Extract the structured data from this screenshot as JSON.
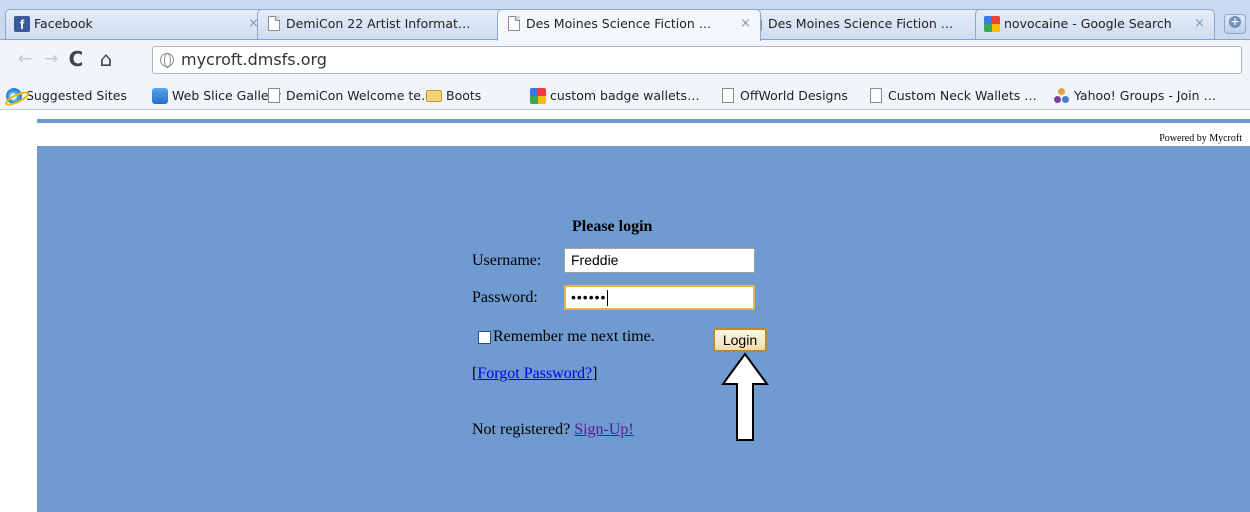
{
  "browser": {
    "tabs": [
      {
        "label": "Facebook",
        "icon": "facebook-icon",
        "active": false
      },
      {
        "label": "DemiCon 22 Artist Informat…",
        "icon": "page-icon",
        "active": false
      },
      {
        "label": "Des Moines Science Fiction …",
        "icon": "page-icon",
        "active": true
      },
      {
        "label": "Des Moines Science Fiction …",
        "icon": "page-icon",
        "active": false
      },
      {
        "label": "novocaine - Google Search",
        "icon": "google-icon",
        "active": false
      }
    ],
    "new_tab_icon": "plus-icon",
    "close_glyph": "×",
    "url": "mycroft.dmsfs.org",
    "bookmarks": [
      {
        "label": "Suggested Sites",
        "icon": "ie-icon"
      },
      {
        "label": "Web Slice Gallery",
        "icon": "web-slice-icon"
      },
      {
        "label": "DemiCon Welcome te…",
        "icon": "page-icon"
      },
      {
        "label": "Boots",
        "icon": "folder-icon"
      },
      {
        "label": "custom badge wallets…",
        "icon": "google-icon"
      },
      {
        "label": "OffWorld Designs",
        "icon": "page-icon"
      },
      {
        "label": "Custom Neck Wallets …",
        "icon": "page-icon"
      },
      {
        "label": "Yahoo! Groups - Join …",
        "icon": "yahoo-groups-icon"
      }
    ]
  },
  "page": {
    "powered_by": "Powered by Mycroft",
    "login": {
      "title": "Please login",
      "username_label": "Username:",
      "username_value": "Freddie",
      "password_label": "Password:",
      "password_mask": "••••••",
      "remember_label": "Remember me next time.",
      "remember_checked": false,
      "login_button": "Login",
      "forgot_open": "[",
      "forgot_link": "Forgot Password?",
      "forgot_close": "]",
      "not_registered": "Not registered?",
      "signup_link": "Sign-Up!"
    }
  },
  "colors": {
    "panel": "#6f9bd1",
    "accent_line": "#6b99cf",
    "link": "#0000ee",
    "visited_link": "#551a8b",
    "focus_border": "#e6b448"
  }
}
